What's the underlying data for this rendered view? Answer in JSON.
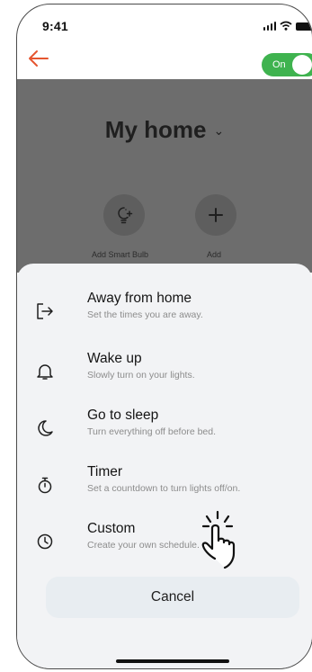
{
  "status_bar": {
    "time": "9:41"
  },
  "header": {
    "toggle_label": "On"
  },
  "home": {
    "title": "My home",
    "chevron": "⌄",
    "actions": [
      {
        "label": "Add Smart Bulb",
        "icon": "bulb-add-icon"
      },
      {
        "label": "Add",
        "icon": "plus-icon"
      }
    ]
  },
  "menu": {
    "options": [
      {
        "title": "Away from home",
        "subtitle": "Set the times you are away.",
        "icon": "away-icon"
      },
      {
        "title": "Wake up",
        "subtitle": "Slowly turn on your lights.",
        "icon": "bell-icon"
      },
      {
        "title": "Go to sleep",
        "subtitle": "Turn everything off before bed.",
        "icon": "moon-icon"
      },
      {
        "title": "Timer",
        "subtitle": "Set a countdown to turn lights off/on.",
        "icon": "stopwatch-icon"
      },
      {
        "title": "Custom",
        "subtitle": "Create your own schedule.",
        "icon": "clock-icon"
      }
    ],
    "cancel_label": "Cancel"
  },
  "colors": {
    "accent": "#e5552f",
    "toggle": "#3fb34f",
    "overlay": "#6d6d6d",
    "sheet": "#f2f3f5"
  }
}
